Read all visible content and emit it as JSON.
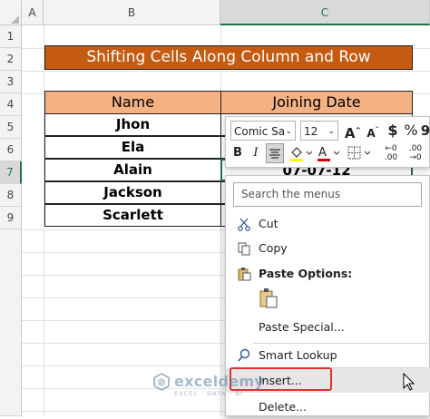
{
  "columns": [
    "A",
    "B",
    "C"
  ],
  "rows": [
    "1",
    "2",
    "3",
    "4",
    "5",
    "6",
    "7",
    "8",
    "9"
  ],
  "sheet": {
    "title": "Shifting Cells Along Column and Row",
    "header_name": "Name",
    "header_date": "Joining Date",
    "names": [
      "Jhon",
      "Ela",
      "Alain",
      "Jackson",
      "Scarlett"
    ],
    "active_value": "07-07-12"
  },
  "mini_toolbar": {
    "font_name": "Comic Sa",
    "font_size": "12",
    "bold": "B",
    "italic": "I",
    "currency": "$",
    "percent": "%",
    "comma": "9",
    "increase_decimal": "←0 .00",
    "decrease_decimal": ".00 →0"
  },
  "context_menu": {
    "search_placeholder": "Search the menus",
    "cut": "Cut",
    "copy": "Copy",
    "paste_options": "Paste Options:",
    "paste_special": "Paste Special...",
    "smart_lookup": "Smart Lookup",
    "insert": "Insert...",
    "delete": "Delete..."
  },
  "watermark": {
    "name": "exceldemy",
    "tagline": "EXCEL · DATA · BI"
  },
  "colors": {
    "title_bg": "#c55a11",
    "header_bg": "#f4b183",
    "excel_green": "#217346",
    "highlight_box": "#e0302c"
  }
}
